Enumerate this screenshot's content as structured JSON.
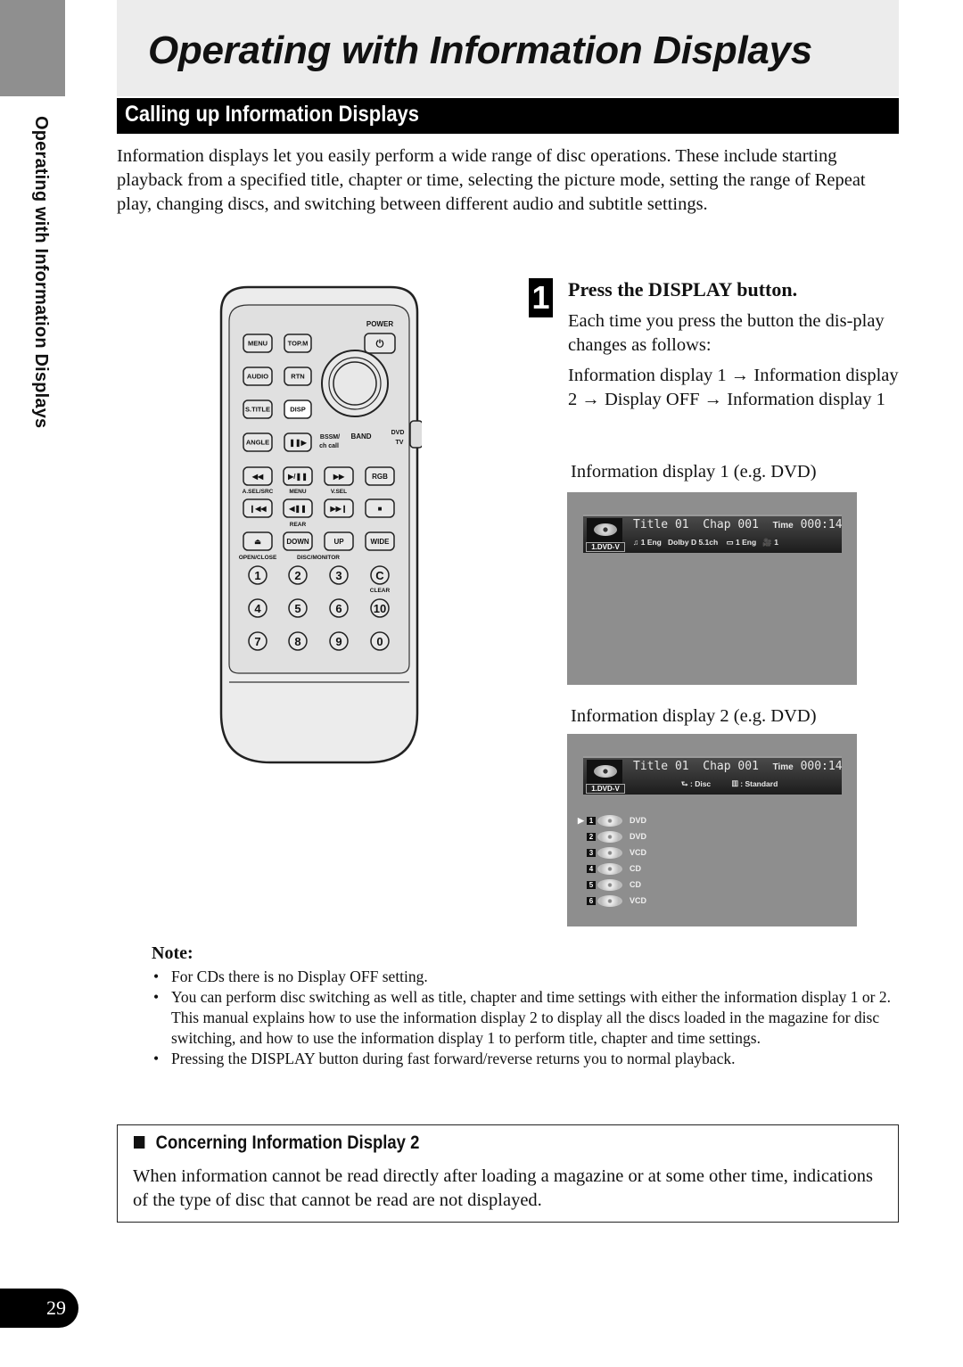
{
  "page": {
    "title": "Operating with Information Displays",
    "side_label": "Operating with Information Displays",
    "page_number": "29"
  },
  "section": {
    "title": "Calling up Information Displays",
    "intro": "Information displays let you easily perform a wide range of disc operations. These include starting playback from a specified title, chapter or time, selecting the picture mode, setting the range of Repeat play, changing discs, and switching between different audio and subtitle settings."
  },
  "remote": {
    "power_label": "POWER",
    "buttons_left": [
      "MENU",
      "AUDIO",
      "S.TITLE",
      "ANGLE"
    ],
    "buttons_mid": [
      "TOP.M",
      "RTN",
      "DISP"
    ],
    "power_icon": "power-icon",
    "bssm_label": "BSSM/",
    "chcall_label": "ch call",
    "band_label": "BAND",
    "dvd_label": "DVD",
    "tv_label": "TV",
    "row1": [
      "◀◀",
      "▶/❚❚",
      "▶▶",
      "RGB"
    ],
    "row1_sub": [
      "A.SEL/SRC",
      "MENU",
      "V.SEL"
    ],
    "row2": [
      "❙◀◀",
      "◀❚❚",
      "▶▶❙",
      "■"
    ],
    "row2_sub": "REAR",
    "row3": [
      "⏏",
      "DOWN",
      "UP",
      "WIDE"
    ],
    "row3_sub": [
      "OPEN/CLOSE",
      "DISC/MONITOR"
    ],
    "numpad": [
      "1",
      "2",
      "3",
      "C",
      "4",
      "5",
      "6",
      "10",
      "7",
      "8",
      "9",
      "0"
    ],
    "clear_label": "CLEAR"
  },
  "step": {
    "number": "1",
    "heading": "Press the DISPLAY button.",
    "body": "Each time you press the button the dis-play changes as follows:",
    "sequence": "Information display 1 → Information display 2 → Display OFF → Information display 1"
  },
  "display1": {
    "caption": "Information display 1 (e.g. DVD)",
    "disc_type": "1.DVD-V",
    "title_label": "Title",
    "title_value": "01",
    "chap_label": "Chap",
    "chap_value": "001",
    "time_label": "Time",
    "time_value": "000:14",
    "audio": "♫ 1 Eng",
    "audio_format": "Dolby D 5.1ch",
    "subtitle": "▭ 1 Eng",
    "angle": "🎥 1"
  },
  "display2": {
    "caption": "Information display 2 (e.g. DVD)",
    "disc_type": "1.DVD-V",
    "title_label": "Title",
    "title_value": "01",
    "chap_label": "Chap",
    "chap_value": "001",
    "time_label": "Time",
    "time_value": "000:14",
    "repeat": "⮑ : Disc",
    "picture": "▥ : Standard",
    "discs": [
      {
        "num": "1",
        "type": "DVD",
        "current": true
      },
      {
        "num": "2",
        "type": "DVD",
        "current": false
      },
      {
        "num": "3",
        "type": "VCD",
        "current": false
      },
      {
        "num": "4",
        "type": "CD",
        "current": false
      },
      {
        "num": "5",
        "type": "CD",
        "current": false
      },
      {
        "num": "6",
        "type": "VCD",
        "current": false
      }
    ]
  },
  "note": {
    "heading": "Note:",
    "items": [
      "For CDs there is no Display OFF setting.",
      "You can perform disc switching as well as title, chapter and time settings with either the information display 1 or 2.",
      "This manual explains how to use the information display 2 to display all the discs loaded in the magazine for disc switching, and how to use the information display 1 to perform title, chapter and time settings.",
      "Pressing the DISPLAY button during fast forward/reverse returns you to normal playback."
    ]
  },
  "box": {
    "title": "Concerning Information Display 2",
    "text": "When information cannot be read directly after loading a magazine or at some other time, indications of the type of disc that cannot be read are not displayed."
  }
}
